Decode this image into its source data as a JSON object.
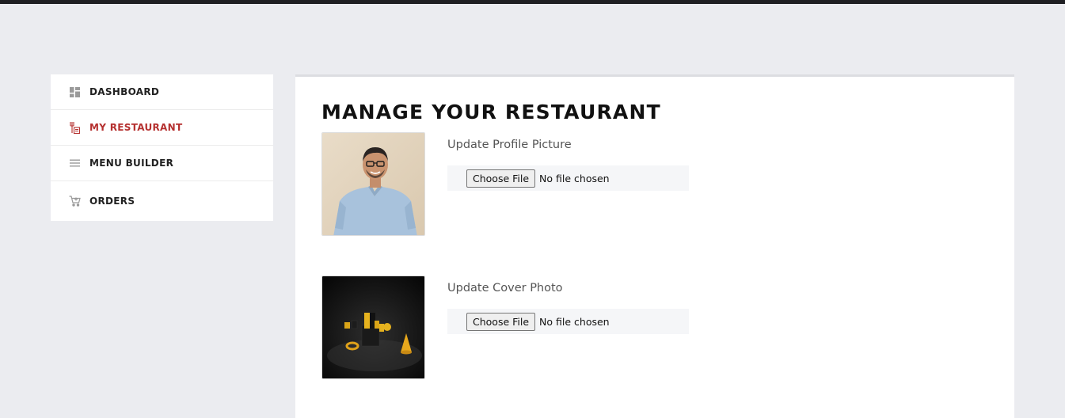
{
  "sidebar": {
    "items": [
      {
        "label": "DASHBOARD",
        "icon": "dashboard-icon",
        "active": false
      },
      {
        "label": "MY RESTAURANT",
        "icon": "restaurant-icon",
        "active": true
      },
      {
        "label": "MENU BUILDER",
        "icon": "menu-lines-icon",
        "active": false
      },
      {
        "label": "ORDERS",
        "icon": "cart-icon",
        "active": false
      }
    ],
    "active_color": "#b5302f"
  },
  "main": {
    "title": "MANAGE YOUR RESTAURANT",
    "profile": {
      "label": "Update Profile Picture",
      "button": "Choose File",
      "status": "No file chosen"
    },
    "cover": {
      "label": "Update Cover Photo",
      "button": "Choose File",
      "status": "No file chosen"
    }
  }
}
